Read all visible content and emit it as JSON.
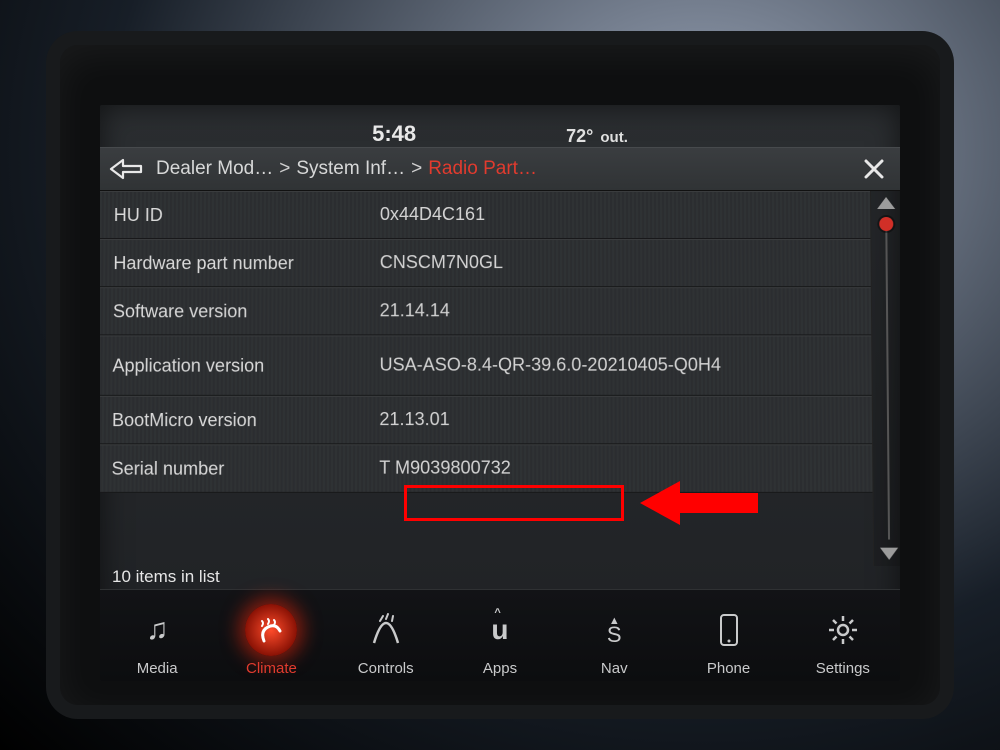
{
  "status": {
    "time": "5:48",
    "temp": "72°",
    "temp_suffix": "out."
  },
  "header": {
    "breadcrumb": [
      {
        "label": "Dealer Mod…",
        "active": false
      },
      {
        "label": "System Inf…",
        "active": false
      },
      {
        "label": "Radio Part…",
        "active": true
      }
    ]
  },
  "rows": [
    {
      "label": "HU ID",
      "value": "0x44D4C161"
    },
    {
      "label": "Hardware part number",
      "value": "CNSCM7N0GL"
    },
    {
      "label": "Software version",
      "value": "21.14.14"
    },
    {
      "label": "Application version",
      "value": "USA-ASO-8.4-QR-39.6.0-20210405-Q0H4"
    },
    {
      "label": "BootMicro version",
      "value": "21.13.01"
    },
    {
      "label": "Serial number",
      "value": "T M9039800732"
    }
  ],
  "list_count_text": "10 items in list",
  "nav": [
    {
      "id": "media",
      "label": "Media",
      "icon": "♫",
      "active": false
    },
    {
      "id": "climate",
      "label": "Climate",
      "icon": "seat",
      "active": true
    },
    {
      "id": "controls",
      "label": "Controls",
      "icon": "controls",
      "active": false
    },
    {
      "id": "apps",
      "label": "Apps",
      "icon": "û",
      "active": false
    },
    {
      "id": "nav",
      "label": "Nav",
      "icon": "S",
      "active": false
    },
    {
      "id": "phone",
      "label": "Phone",
      "icon": "phone",
      "active": false
    },
    {
      "id": "settings",
      "label": "Settings",
      "icon": "gear",
      "active": false
    }
  ],
  "annotation": {
    "highlight_row_index": 5
  }
}
